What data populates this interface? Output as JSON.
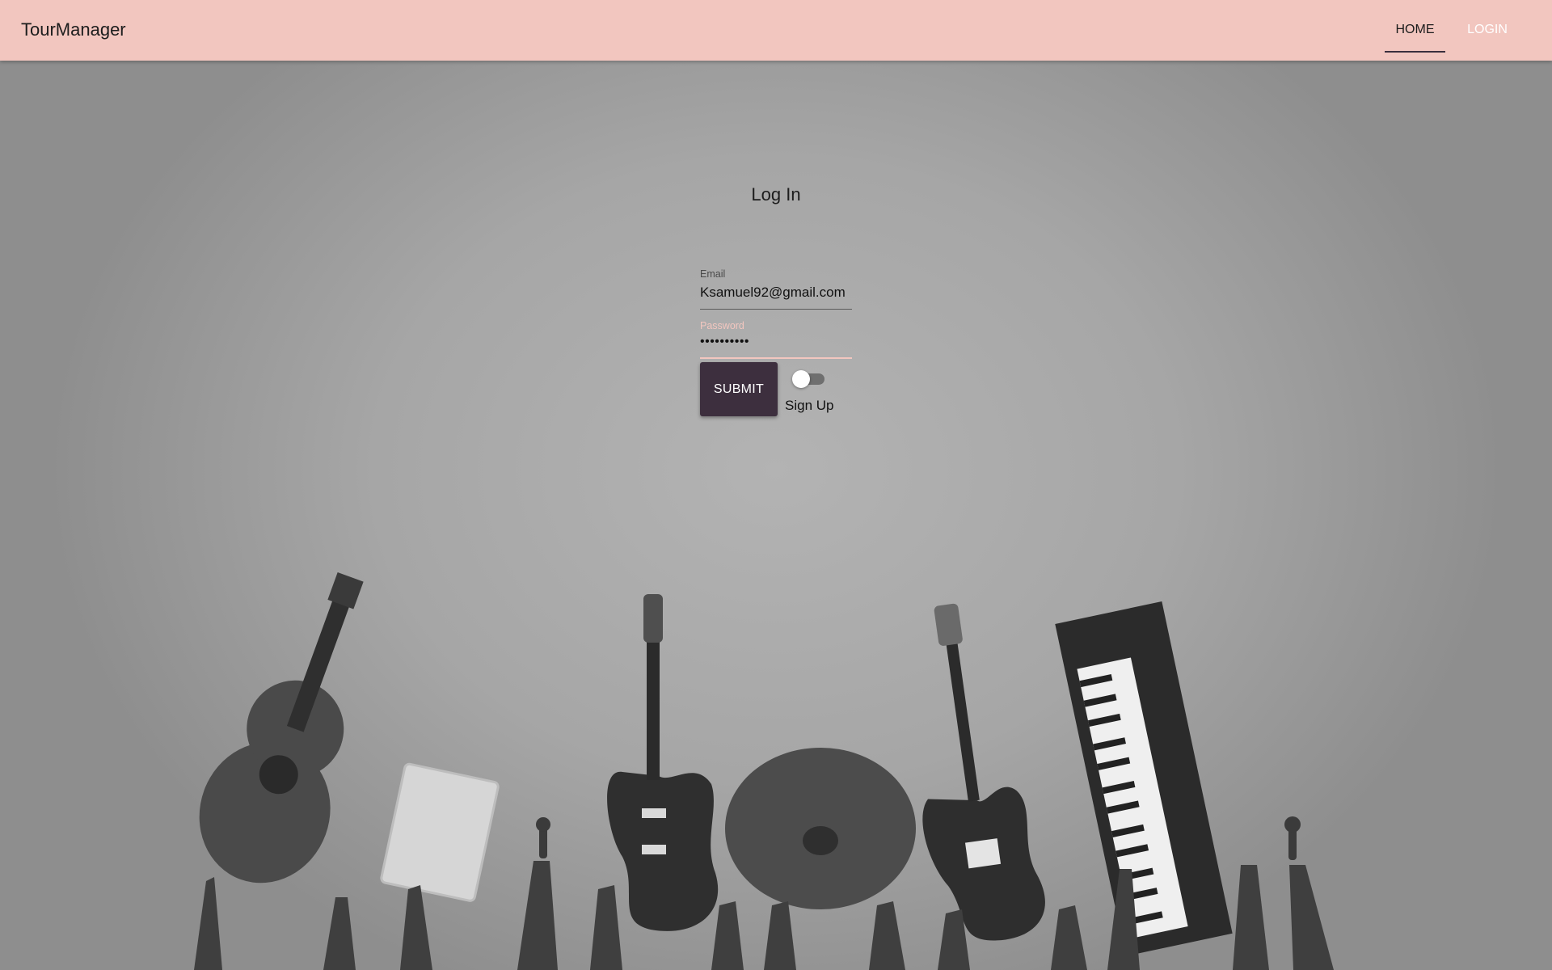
{
  "appbar": {
    "brand": "TourManager",
    "tabs": [
      {
        "label": "HOME",
        "active": true
      },
      {
        "label": "LOGIN",
        "active": false
      }
    ],
    "color": "#f2c6bf"
  },
  "login": {
    "title": "Log In",
    "email": {
      "label": "Email",
      "value": "Ksamuel92@gmail.com"
    },
    "password": {
      "label": "Password",
      "value": "••••••••••"
    },
    "submit_label": "SUBMIT",
    "signup_toggle": {
      "label": "Sign Up",
      "checked": false
    },
    "button_color": "#3d2f3e"
  },
  "background": {
    "description_icon": "band-instruments-photo-icon"
  }
}
